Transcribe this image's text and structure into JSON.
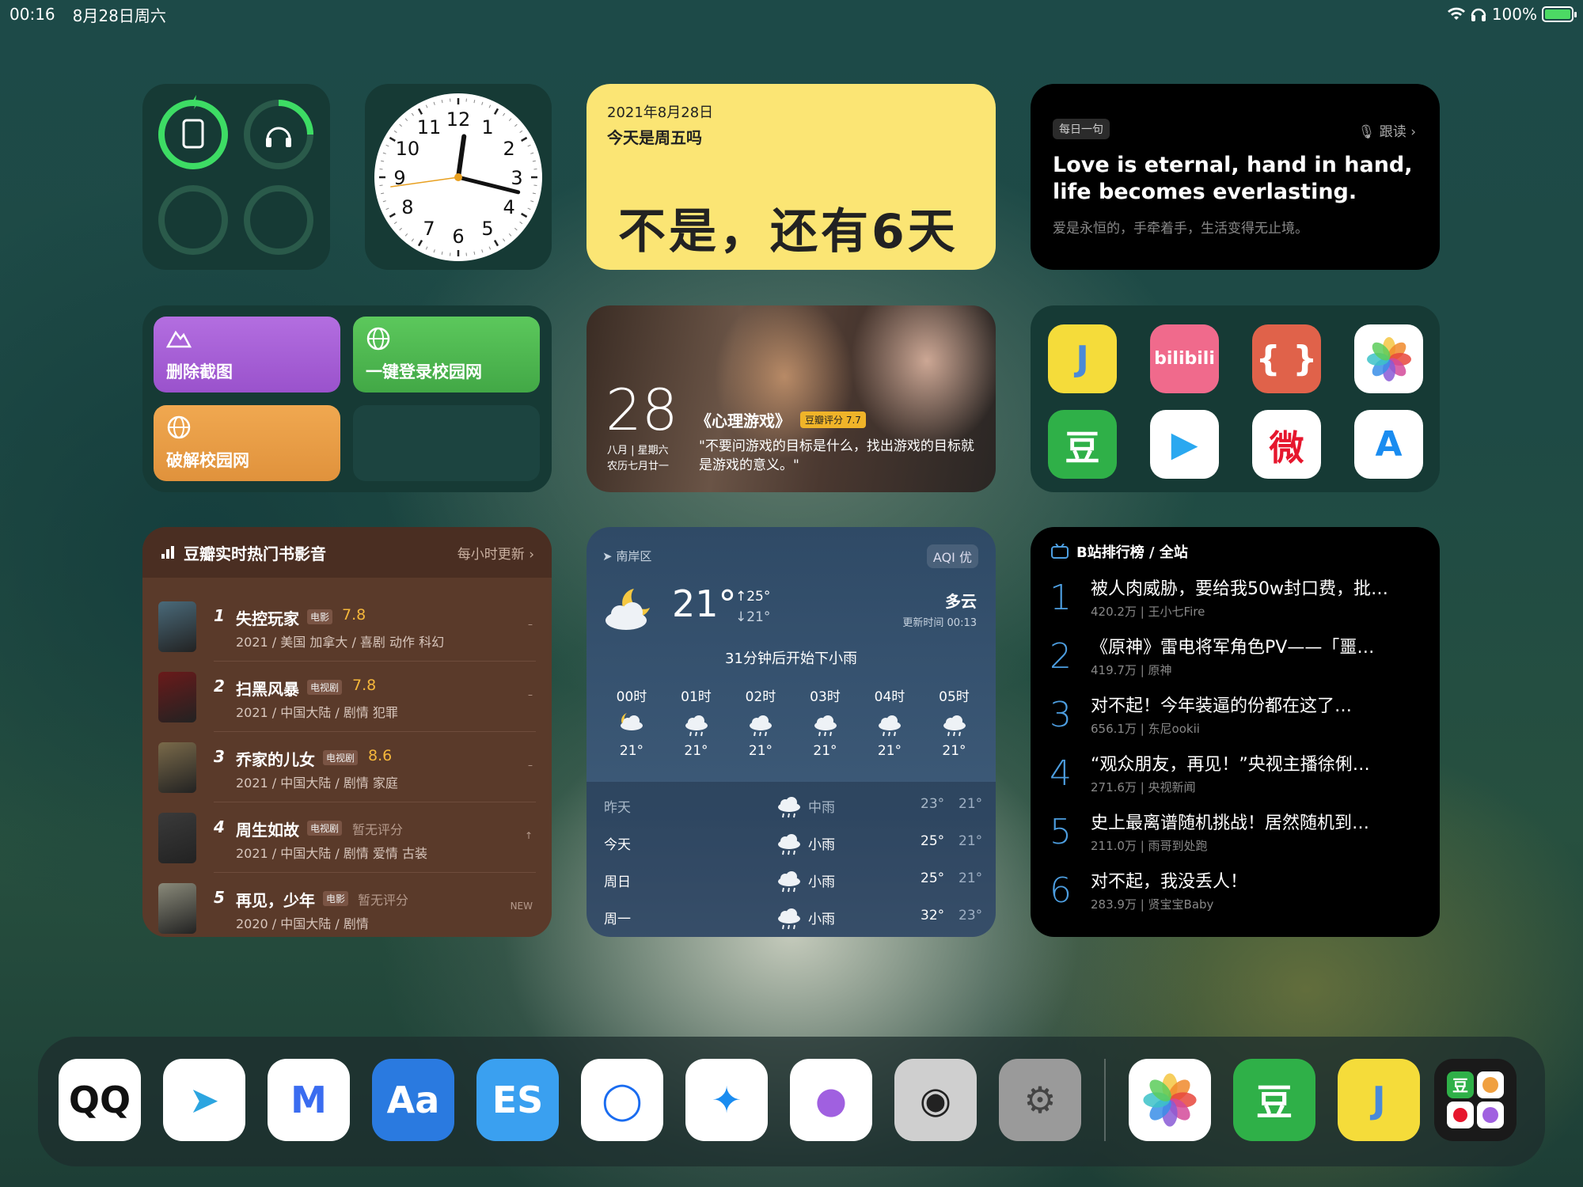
{
  "status_bar": {
    "time": "00:16",
    "date": "8月28日周六",
    "battery": "100%"
  },
  "clock_numbers": [
    "12",
    "1",
    "2",
    "3",
    "4",
    "5",
    "6",
    "7",
    "8",
    "9",
    "10",
    "11"
  ],
  "date_widget": {
    "date": "2021年8月28日",
    "question": "今天是周五吗",
    "answer": "不是，还有6天"
  },
  "quote_widget": {
    "tag": "每日一句",
    "follow": "跟读",
    "english": "Love is eternal, hand in hand, life becomes everlasting.",
    "chinese": "爱是永恒的，手牵着手，生活变得无止境。"
  },
  "shortcuts": [
    {
      "label": "删除截图",
      "icon": "mountain-icon",
      "color": "#a45ad6"
    },
    {
      "label": "一键登录校园网",
      "icon": "globe-icon",
      "color": "#4cb34f"
    },
    {
      "label": "破解校园网",
      "icon": "globe-icon",
      "color": "#e8a040"
    }
  ],
  "movie_widget": {
    "day": "28",
    "lunar1": "八月 | 星期六",
    "lunar2": "农历七月廿一",
    "title": "《心理游戏》",
    "badge": "豆瓣评分 7.7",
    "quote": "\"不要问游戏的目标是什么，找出游戏的目标就是游戏的意义。\""
  },
  "apps_widget": [
    {
      "name": "j-app",
      "label": "J",
      "bg": "#f5dc3a",
      "fg": "#4a8ad8"
    },
    {
      "name": "bilibili",
      "label": "bilibili",
      "bg": "#f06a8c",
      "fg": "#fff"
    },
    {
      "name": "code-app",
      "label": "{ }",
      "bg": "#e0624a",
      "fg": "#fff"
    },
    {
      "name": "photos",
      "label": "",
      "bg": "#ffffff",
      "fg": "#fff"
    },
    {
      "name": "douban",
      "label": "豆",
      "bg": "#2fb048",
      "fg": "#fff"
    },
    {
      "name": "tencent-video",
      "label": "▶",
      "bg": "#ffffff",
      "fg": "#2aa8f0"
    },
    {
      "name": "weibo",
      "label": "微",
      "bg": "#ffffff",
      "fg": "#e6162d"
    },
    {
      "name": "app-store",
      "label": "A",
      "bg": "#ffffff",
      "fg": "#1a8cf0"
    }
  ],
  "douban": {
    "title": "豆瓣实时热门书影音",
    "update": "每小时更新 ›",
    "items": [
      {
        "rank": "1",
        "name": "失控玩家",
        "kind": "电影",
        "score": "7.8",
        "meta": "2021 / 美国 加拿大 / 喜剧 动作 科幻",
        "trend": "–",
        "color": "#4a6a7a"
      },
      {
        "rank": "2",
        "name": "扫黑风暴",
        "kind": "电视剧",
        "score": "7.8",
        "meta": "2021 / 中国大陆 / 剧情 犯罪",
        "trend": "–",
        "color": "#6a1a1a"
      },
      {
        "rank": "3",
        "name": "乔家的儿女",
        "kind": "电视剧",
        "score": "8.6",
        "meta": "2021 / 中国大陆 / 剧情 家庭",
        "trend": "–",
        "color": "#7a6a4a"
      },
      {
        "rank": "4",
        "name": "周生如故",
        "kind": "电视剧",
        "score": "暂无评分",
        "meta": "2021 / 中国大陆 / 剧情 爱情 古装",
        "trend": "↑",
        "color": "#3a3a3a"
      },
      {
        "rank": "5",
        "name": "再见，少年",
        "kind": "电影",
        "score": "暂无评分",
        "meta": "2020 / 中国大陆 / 剧情",
        "trend": "NEW",
        "color": "#8a8a7a"
      }
    ]
  },
  "weather": {
    "location": "南岸区",
    "aqi": "AQI 优",
    "temp": "21°",
    "high": "↑25°",
    "low": "↓21°",
    "condition": "多云",
    "updated": "更新时间  00:13",
    "summary": "31分钟后开始下小雨",
    "hourly": [
      {
        "hour": "00时",
        "icon": "moon-cloud-icon",
        "temp": "21°"
      },
      {
        "hour": "01时",
        "icon": "rain-icon",
        "temp": "21°"
      },
      {
        "hour": "02时",
        "icon": "rain-icon",
        "temp": "21°"
      },
      {
        "hour": "03时",
        "icon": "rain-icon",
        "temp": "21°"
      },
      {
        "hour": "04时",
        "icon": "rain-icon",
        "temp": "21°"
      },
      {
        "hour": "05时",
        "icon": "rain-icon",
        "temp": "21°"
      }
    ],
    "daily": [
      {
        "day": "昨天",
        "cond": "中雨",
        "high": "23°",
        "low": "21°"
      },
      {
        "day": "今天",
        "cond": "小雨",
        "high": "25°",
        "low": "21°"
      },
      {
        "day": "周日",
        "cond": "小雨",
        "high": "25°",
        "low": "21°"
      },
      {
        "day": "周一",
        "cond": "小雨",
        "high": "32°",
        "low": "23°"
      }
    ]
  },
  "bilibili": {
    "title": "B站排行榜 / 全站",
    "items": [
      {
        "rank": "1",
        "title": "被人肉威胁，要给我50w封口费，批…",
        "meta": "420.2万 | 王小七Fire"
      },
      {
        "rank": "2",
        "title": "《原神》雷电将军角色PV——「噩…",
        "meta": "419.7万 | 原神"
      },
      {
        "rank": "3",
        "title": "对不起！今年装逼的份都在这了…",
        "meta": "656.1万 | 东尼ookii"
      },
      {
        "rank": "4",
        "title": "“观众朋友，再见！”央视主播徐俐…",
        "meta": "271.6万 | 央视新闻"
      },
      {
        "rank": "5",
        "title": "史上最离谱随机挑战！居然随机到…",
        "meta": "211.0万 | 雨哥到处跑"
      },
      {
        "rank": "6",
        "title": "对不起，我没丢人！",
        "meta": "283.9万 | 贤宝宝Baby"
      }
    ]
  },
  "dock": [
    {
      "name": "qq",
      "label": "QQ",
      "bg": "#ffffff",
      "fg": "#111"
    },
    {
      "name": "telegram",
      "label": "➤",
      "bg": "#ffffff",
      "fg": "#2ca5e0"
    },
    {
      "name": "m-app",
      "label": "M",
      "bg": "#ffffff",
      "fg": "#3a6cf0"
    },
    {
      "name": "dictionary",
      "label": "Aa",
      "bg": "#2a7ae0",
      "fg": "#fff"
    },
    {
      "name": "es-file",
      "label": "ES",
      "bg": "#3aa0f0",
      "fg": "#fff"
    },
    {
      "name": "circle-app",
      "label": "◯",
      "bg": "#ffffff",
      "fg": "#1a6cf0"
    },
    {
      "name": "safari",
      "label": "✦",
      "bg": "#ffffff",
      "fg": "#1a8cf0"
    },
    {
      "name": "balloon-app",
      "label": "●",
      "bg": "#ffffff",
      "fg": "#a060e0"
    },
    {
      "name": "camera",
      "label": "◉",
      "bg": "#cfcfcf",
      "fg": "#222"
    },
    {
      "name": "settings",
      "label": "⚙",
      "bg": "#9a9a9a",
      "fg": "#444"
    },
    {
      "name": "photos",
      "label": "",
      "bg": "#ffffff",
      "fg": "#fff"
    },
    {
      "name": "douban",
      "label": "豆",
      "bg": "#2fb048",
      "fg": "#fff"
    },
    {
      "name": "j-app",
      "label": "J",
      "bg": "#f5dc3a",
      "fg": "#4a8ad8"
    }
  ]
}
